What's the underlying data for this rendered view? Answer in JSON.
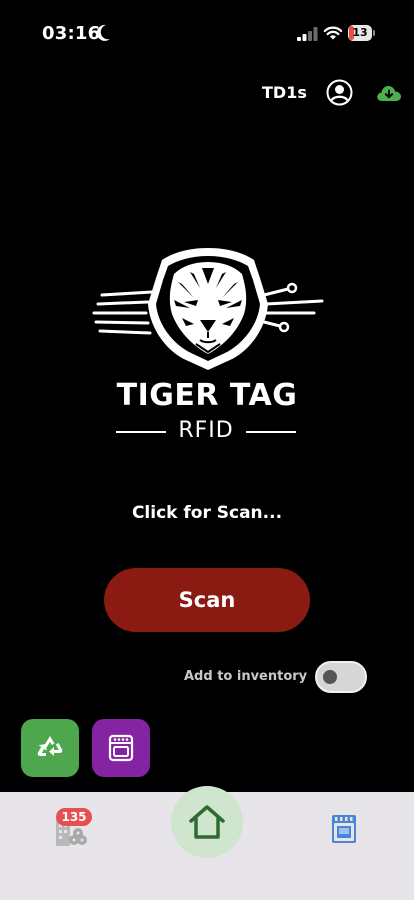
{
  "status_bar": {
    "time": "03:16",
    "battery": "13"
  },
  "header": {
    "title": "TD1s"
  },
  "logo": {
    "title": "TIGER TAG",
    "subtitle": "RFID"
  },
  "main": {
    "prompt": "Click for Scan...",
    "scan_label": "Scan",
    "inventory_label": "Add to inventory",
    "inventory_enabled": false
  },
  "tabbar": {
    "inventory_badge": "135"
  },
  "colors": {
    "scan_button": "#8a1b12",
    "recycle_tile": "#4fa74d",
    "dryer_tile": "#8424a2",
    "cloud_download": "#4caf50",
    "badge": "#e55050",
    "home_bg": "#cfe5cd"
  },
  "icons": [
    "moon-icon",
    "signal-icon",
    "wifi-icon",
    "battery-icon",
    "profile-icon",
    "cloud-download-icon",
    "tiger-logo",
    "recycle-icon",
    "dryer-icon",
    "inventory-icon",
    "home-icon",
    "dryer-tab-icon"
  ]
}
